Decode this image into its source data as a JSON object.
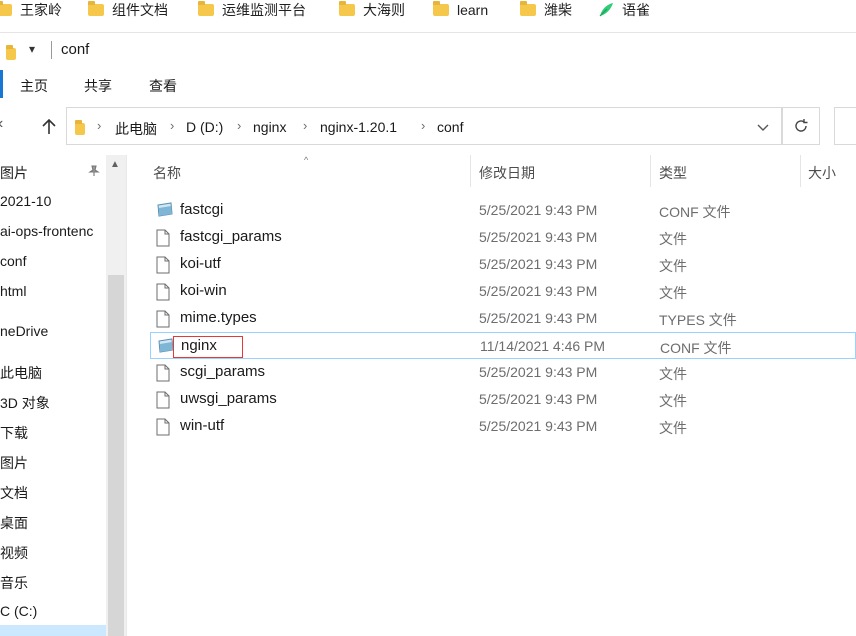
{
  "bookmarks": [
    {
      "label": "王家岭",
      "icon": "folder-icon"
    },
    {
      "label": "组件文档",
      "icon": "folder-icon"
    },
    {
      "label": "运维监测平台",
      "icon": "folder-icon"
    },
    {
      "label": "大海则",
      "icon": "folder-icon"
    },
    {
      "label": "learn",
      "icon": "folder-icon"
    },
    {
      "label": "潍柴",
      "icon": "folder-icon"
    },
    {
      "label": "语雀",
      "icon": "yuque-leaf-icon"
    }
  ],
  "window": {
    "title": "conf",
    "quick_access_dropdown": "▾"
  },
  "ribbon": {
    "tabs": [
      "主页",
      "共享",
      "查看"
    ]
  },
  "address": {
    "crumbs": [
      "此电脑",
      "D (D:)",
      "nginx",
      "nginx-1.20.1",
      "conf"
    ],
    "dropdown_icon": "chevron-down-icon",
    "refresh_icon": "refresh-icon"
  },
  "nav": {
    "items": [
      "图片",
      "2021-10",
      "ai-ops-frontenc",
      "conf",
      "html",
      "neDrive",
      "此电脑",
      "3D 对象",
      "下载",
      "图片",
      "文档",
      "桌面",
      "视频",
      "音乐",
      "C (C:)"
    ],
    "pin_icon": "pin-icon"
  },
  "columns": {
    "name": "名称",
    "date": "修改日期",
    "type": "类型",
    "size": "大小"
  },
  "files": [
    {
      "name": "fastcgi",
      "date": "5/25/2021 9:43 PM",
      "type": "CONF 文件",
      "icon": "conf-file-icon",
      "selected": false
    },
    {
      "name": "fastcgi_params",
      "date": "5/25/2021 9:43 PM",
      "type": "文件",
      "icon": "blank-file-icon",
      "selected": false
    },
    {
      "name": "koi-utf",
      "date": "5/25/2021 9:43 PM",
      "type": "文件",
      "icon": "blank-file-icon",
      "selected": false
    },
    {
      "name": "koi-win",
      "date": "5/25/2021 9:43 PM",
      "type": "文件",
      "icon": "blank-file-icon",
      "selected": false
    },
    {
      "name": "mime.types",
      "date": "5/25/2021 9:43 PM",
      "type": "TYPES 文件",
      "icon": "blank-file-icon",
      "selected": false
    },
    {
      "name": "nginx",
      "date": "11/14/2021 4:46 PM",
      "type": "CONF 文件",
      "icon": "conf-file-icon",
      "selected": true
    },
    {
      "name": "scgi_params",
      "date": "5/25/2021 9:43 PM",
      "type": "文件",
      "icon": "blank-file-icon",
      "selected": false
    },
    {
      "name": "uwsgi_params",
      "date": "5/25/2021 9:43 PM",
      "type": "文件",
      "icon": "blank-file-icon",
      "selected": false
    },
    {
      "name": "win-utf",
      "date": "5/25/2021 9:43 PM",
      "type": "文件",
      "icon": "blank-file-icon",
      "selected": false
    }
  ],
  "colors": {
    "accent": "#1976d2",
    "selection_border": "#99d1ff",
    "highlight_box": "#e53935",
    "folder": "#f5c84c"
  }
}
